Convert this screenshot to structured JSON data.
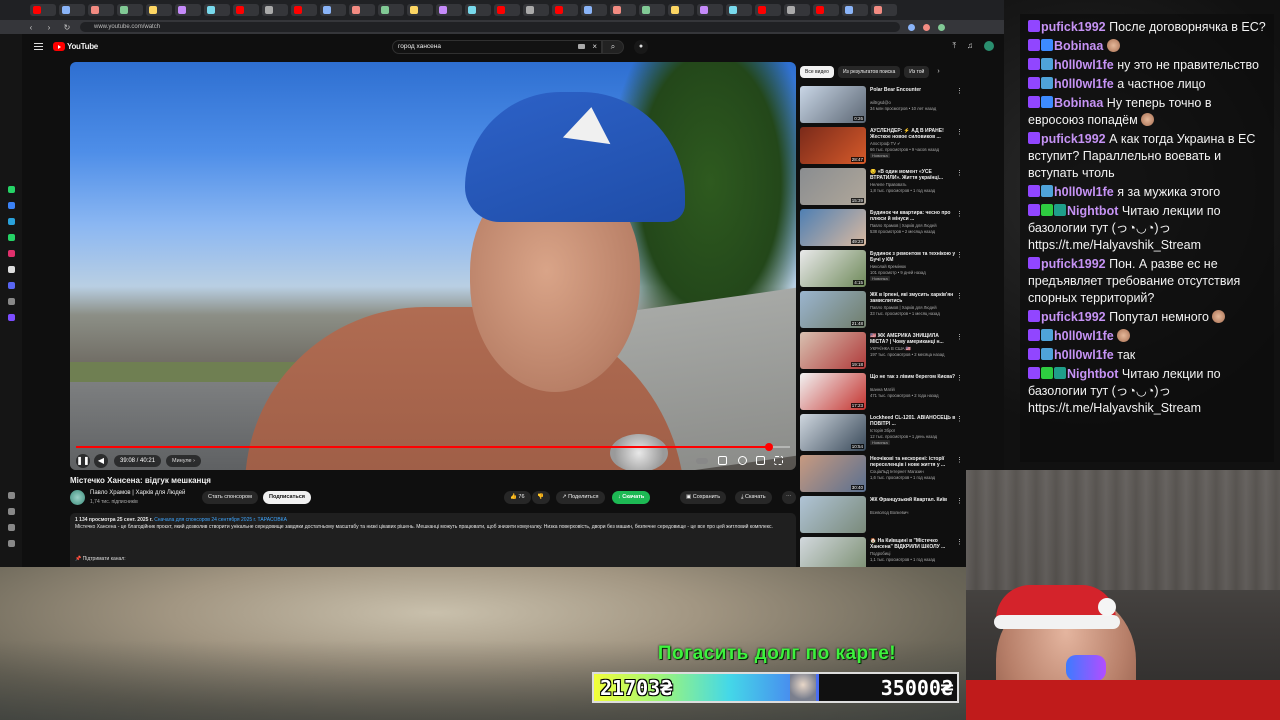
{
  "browser": {
    "url": "www.youtube.com/watch"
  },
  "youtube": {
    "logo_text": "YouTube",
    "search_query": "город хансена",
    "video": {
      "title": "Містечко Хансена: відгук мешканця",
      "time": "39:08 / 40:21",
      "chapter": "Минуле",
      "progress_fraction": 0.97
    },
    "channel": {
      "name": "Павло Храмов | Харків для Людей",
      "subs": "1,74 тис. підписників",
      "sponsor_label": "Стать спонсором",
      "subscribe_label": "Подписаться"
    },
    "actions": {
      "likes": "76",
      "share": "Поделиться",
      "download": "Скачать",
      "save": "Сохранить",
      "download2": "Скачать"
    },
    "description": {
      "stats": "1 134 просмотра  25 сент. 2025 г.",
      "highlight": "Сначала для спонсоров 24 сентября 2025 г.  ТАРАСОВКА",
      "body": "Містечко Хансена - це благодійник проєкт, який дозволив створити унікальне середовище завдяки достатньому масштабу та низкі цікавих рішень. Мешканці можуть працювати, щоб знизити комуналку. Низка поверховість, двори без машин, безпечне середовище - це все про цей житловий комплекс.",
      "support": "Підтримати канал:"
    },
    "chips": [
      "Все видео",
      "Из результатов поиска",
      "Из той"
    ],
    "recommendations": [
      {
        "title": "Polar Bear Encounter",
        "channel": "wiltrgsd@o",
        "meta": "34 млн просмотров • 10 лет назад",
        "duration": "0:26",
        "badge": "",
        "colors": [
          "#c9d6e6",
          "#5c6774"
        ]
      },
      {
        "title": "АУСЛЕНДЕР: ⚡ АД В ИРАНЕ! Жесткое новое силовиков ...",
        "channel": "Апостроф TV ✔",
        "meta": "66 тыс. просмотров • 9 часов назад",
        "duration": "28:47",
        "badge": "Новинка",
        "colors": [
          "#7a2a1a",
          "#d65a2a"
        ]
      },
      {
        "title": "😏 «В один момент «УСЕ ВТРАТИЛИ». Життя українці...",
        "channel": "Нелепе Правовать",
        "meta": "1,8 тыс. просмотров • 1 год назад",
        "duration": "15:39",
        "badge": "",
        "colors": [
          "#8a8d90",
          "#b0a79a"
        ]
      },
      {
        "title": "Будинок чи квартира: чесно про плюси й мінуси ...",
        "channel": "Павло Храмов | Харків для Людей",
        "meta": "538 просмотров • 2 месяца назад",
        "duration": "49:23",
        "badge": "",
        "colors": [
          "#4f7fb3",
          "#d9b9a0"
        ]
      },
      {
        "title": "Будинок з ремонтом та технікою у Бучі у КМ",
        "channel": "Николай Кремінюк",
        "meta": "101 просмотр • 9 дней назад",
        "duration": "4:15",
        "badge": "Новинка",
        "colors": [
          "#e9e9ea",
          "#6f8a5a"
        ]
      },
      {
        "title": "ЖК в Ірпені, які змусить харків'ян замислитись",
        "channel": "Павло Храмов | Харків для Людей",
        "meta": "33 тыс. просмотров • 1 месяц назад",
        "duration": "21:48",
        "badge": "",
        "colors": [
          "#9bb5cf",
          "#6f7d6a"
        ]
      },
      {
        "title": "🇺🇸 ЖК АМЕРИКА ЗНИЩИЛА МІСТА? | Чому американці н...",
        "channel": "УКРАЇНКА В США 🇺🇸",
        "meta": "197 тыс. просмотров • 2 месяца назад",
        "duration": "19:18",
        "badge": "",
        "colors": [
          "#d8c0b0",
          "#b03a3a"
        ]
      },
      {
        "title": "Що не так з лівим берегом Києва?",
        "channel": "Іванна Матій",
        "meta": "471 тыс. просмотров • 2 года назад",
        "duration": "17:23",
        "badge": "",
        "colors": [
          "#f2f2f2",
          "#c4332f"
        ]
      },
      {
        "title": "Lockheed CL-1201. АВІАНОСЕЦЬ в ПОВІТРІ ...",
        "channel": "Історія Зброї",
        "meta": "12 тыс. просмотров • 1 день назад",
        "duration": "10:54",
        "badge": "Новинка",
        "colors": [
          "#cfd7df",
          "#3a4a5a"
        ]
      },
      {
        "title": "Неочікові та нескорені: історії переселенців і нове життя у ...",
        "channel": "СоціаЛьД Інтернет Магазин",
        "meta": "1,6 тыс. просмотров • 1 год назад",
        "duration": "30:40",
        "badge": "",
        "colors": [
          "#c89a80",
          "#5a7090"
        ]
      },
      {
        "title": "ЖК Французький Квартал. Київ",
        "channel": "Всеволод Волкевич",
        "meta": "",
        "duration": "",
        "badge": "",
        "colors": [
          "#b0c4d6",
          "#7a8a7a"
        ]
      },
      {
        "title": "🏠 На Київщині в \"Містечко Хансена\" ВІДКРИЛИ ШКОЛУ ...",
        "channel": "Подробиці",
        "meta": "1,1 тыс. просмотров • 1 год назад",
        "duration": "",
        "badge": "",
        "colors": [
          "#d2d8dd",
          "#7a8e70"
        ]
      }
    ]
  },
  "chat": {
    "messages": [
      {
        "user": "pufick1992",
        "user_color": "#c693f5",
        "text": "После договорнячка в ЕС?",
        "badges": [
          "#9146ff"
        ]
      },
      {
        "user": "Bobinaa",
        "user_color": "#c693f5",
        "text": "",
        "badges": [
          "#9146ff",
          "#3d8bff"
        ],
        "emote": true
      },
      {
        "user": "h0ll0wl1fe",
        "user_color": "#c693f5",
        "text": "ну это не правительство",
        "badges": [
          "#9146ff",
          "#4fa3d9"
        ]
      },
      {
        "user": "h0ll0wl1fe",
        "user_color": "#c693f5",
        "text": "а частное лицо",
        "badges": [
          "#9146ff",
          "#4fa3d9"
        ]
      },
      {
        "user": "Bobinaa",
        "user_color": "#c693f5",
        "text": "Ну теперь точно в евросоюз попадём",
        "badges": [
          "#9146ff",
          "#3d8bff"
        ],
        "emote": true
      },
      {
        "user": "pufick1992",
        "user_color": "#c693f5",
        "text": "А как тогда Украина в ЕС вступит? Параллельно воевать и вступать чтоль",
        "badges": [
          "#9146ff"
        ]
      },
      {
        "user": "h0ll0wl1fe",
        "user_color": "#c693f5",
        "text": "я за мужика этого",
        "badges": [
          "#9146ff",
          "#4fa3d9"
        ]
      },
      {
        "user": "Nightbot",
        "user_color": "#c693f5",
        "text": "Читаю лекции по базологии тут (っ◔◡◔)っ https://t.me/Halyavshik_Stream",
        "badges": [
          "#9146ff",
          "#2ecc40",
          "#1f9e8a"
        ]
      },
      {
        "user": "pufick1992",
        "user_color": "#c693f5",
        "text": "Пон. А разве ес не предъявляет требование отсутствия спорных территорий?",
        "badges": [
          "#9146ff"
        ]
      },
      {
        "user": "pufick1992",
        "user_color": "#c693f5",
        "text": "Попутал немного",
        "badges": [
          "#9146ff"
        ],
        "emote": true
      },
      {
        "user": "h0ll0wl1fe",
        "user_color": "#c693f5",
        "text": "",
        "badges": [
          "#9146ff",
          "#4fa3d9"
        ],
        "emote": true
      },
      {
        "user": "h0ll0wl1fe",
        "user_color": "#c693f5",
        "text": "так",
        "badges": [
          "#9146ff",
          "#4fa3d9"
        ]
      },
      {
        "user": "Nightbot",
        "user_color": "#c693f5",
        "text": "Читаю лекции по базологии тут (っ◔◡◔)っ https://t.me/Halyavshik_Stream",
        "badges": [
          "#9146ff",
          "#2ecc40",
          "#1f9e8a"
        ]
      }
    ]
  },
  "goal": {
    "title": "Погасить долг по карте!",
    "current": "21703₴",
    "target": "35000₴",
    "fraction": 0.62
  }
}
